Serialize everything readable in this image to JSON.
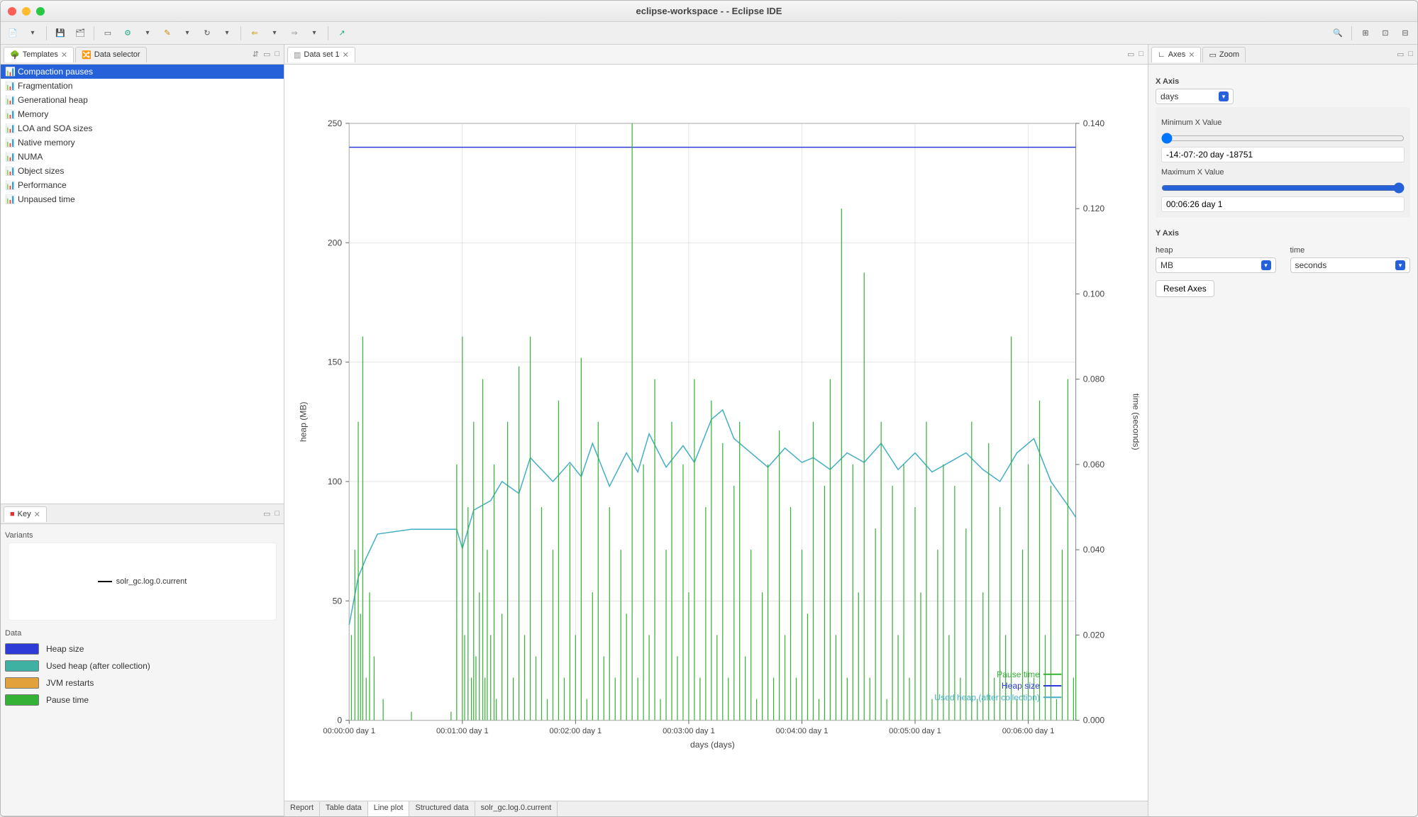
{
  "window": {
    "title": "eclipse-workspace -  - Eclipse IDE"
  },
  "left": {
    "templates_tab": "Templates",
    "data_selector_tab": "Data selector",
    "templates": [
      "Compaction pauses",
      "Fragmentation",
      "Generational heap",
      "Memory",
      "LOA and SOA sizes",
      "Native memory",
      "NUMA",
      "Object sizes",
      "Performance",
      "Unpaused time"
    ],
    "selected_index": 0,
    "key_tab": "Key",
    "variants_label": "Variants",
    "variant_name": "solr_gc.log.0.current",
    "data_label": "Data",
    "legend": [
      {
        "label": "Heap size",
        "color": "#2e3bd6"
      },
      {
        "label": "Used heap (after collection)",
        "color": "#3fb1a3"
      },
      {
        "label": "JVM restarts",
        "color": "#e2a23b"
      },
      {
        "label": "Pause time",
        "color": "#35b135"
      }
    ]
  },
  "center": {
    "tab": "Data set 1",
    "bottom_tabs": [
      "Report",
      "Table data",
      "Line plot",
      "Structured data",
      "solr_gc.log.0.current"
    ],
    "bottom_active": 2
  },
  "right": {
    "axes_tab": "Axes",
    "zoom_tab": "Zoom",
    "x_axis_label": "X Axis",
    "x_unit": "days",
    "min_x_label": "Minimum X Value",
    "min_x_value": "-14:-07:-20 day -18751",
    "max_x_label": "Maximum X Value",
    "max_x_value": "00:06:26 day 1",
    "y_axis_label": "Y Axis",
    "heap_label": "heap",
    "heap_unit": "MB",
    "time_label": "time",
    "time_unit": "seconds",
    "reset": "Reset Axes"
  },
  "chart_data": {
    "type": "line",
    "title": "",
    "xlabel": "days (days)",
    "y1": {
      "label": "heap (MB)",
      "ticks": [
        0,
        50,
        100,
        150,
        200,
        250
      ]
    },
    "y2": {
      "label": "time (seconds)",
      "ticks": [
        0.0,
        0.02,
        0.04,
        0.06,
        0.08,
        0.1,
        0.12,
        0.14
      ]
    },
    "x_ticks": [
      "00:00:00 day 1",
      "00:01:00 day 1",
      "00:02:00 day 1",
      "00:03:00 day 1",
      "00:04:00 day 1",
      "00:05:00 day 1",
      "00:06:00 day 1"
    ],
    "x_range": [
      0,
      6.42
    ],
    "legend_inplot": [
      "Pause time",
      "Heap size",
      "Used heap (after collection)"
    ],
    "series": [
      {
        "name": "Heap size",
        "axis": "y1",
        "color": "#2e3bd6",
        "x": [
          0,
          6.42
        ],
        "y": [
          240,
          240
        ]
      },
      {
        "name": "Used heap (after collection)",
        "axis": "y1",
        "color": "#45b0c4",
        "x": [
          0.0,
          0.08,
          0.15,
          0.25,
          0.55,
          0.95,
          1.0,
          1.1,
          1.25,
          1.35,
          1.5,
          1.6,
          1.8,
          1.95,
          2.05,
          2.15,
          2.3,
          2.45,
          2.55,
          2.65,
          2.8,
          2.95,
          3.05,
          3.2,
          3.3,
          3.4,
          3.55,
          3.7,
          3.85,
          4.0,
          4.1,
          4.25,
          4.4,
          4.55,
          4.7,
          4.85,
          5.0,
          5.15,
          5.3,
          5.45,
          5.6,
          5.75,
          5.9,
          6.05,
          6.2,
          6.35,
          6.42
        ],
        "y": [
          40,
          60,
          68,
          78,
          80,
          80,
          72,
          88,
          92,
          100,
          95,
          110,
          100,
          108,
          102,
          116,
          98,
          112,
          104,
          120,
          106,
          115,
          108,
          126,
          130,
          118,
          112,
          106,
          114,
          108,
          110,
          105,
          112,
          108,
          116,
          105,
          112,
          104,
          108,
          112,
          105,
          100,
          112,
          118,
          100,
          90,
          85
        ]
      },
      {
        "name": "Pause time",
        "axis": "y2",
        "color": "#35b135",
        "x": [
          0.02,
          0.05,
          0.08,
          0.1,
          0.12,
          0.15,
          0.18,
          0.22,
          0.3,
          0.55,
          0.9,
          0.95,
          1.0,
          1.02,
          1.05,
          1.08,
          1.1,
          1.12,
          1.15,
          1.18,
          1.2,
          1.22,
          1.25,
          1.28,
          1.3,
          1.35,
          1.4,
          1.45,
          1.5,
          1.55,
          1.6,
          1.65,
          1.7,
          1.75,
          1.8,
          1.85,
          1.9,
          1.95,
          2.0,
          2.05,
          2.1,
          2.15,
          2.2,
          2.25,
          2.3,
          2.35,
          2.4,
          2.45,
          2.5,
          2.55,
          2.6,
          2.65,
          2.7,
          2.75,
          2.8,
          2.85,
          2.9,
          2.95,
          3.0,
          3.05,
          3.1,
          3.15,
          3.2,
          3.25,
          3.3,
          3.35,
          3.4,
          3.45,
          3.5,
          3.55,
          3.6,
          3.65,
          3.7,
          3.75,
          3.8,
          3.85,
          3.9,
          3.95,
          4.0,
          4.05,
          4.1,
          4.15,
          4.2,
          4.25,
          4.3,
          4.35,
          4.4,
          4.45,
          4.5,
          4.55,
          4.6,
          4.65,
          4.7,
          4.75,
          4.8,
          4.85,
          4.9,
          4.95,
          5.0,
          5.05,
          5.1,
          5.15,
          5.2,
          5.25,
          5.3,
          5.35,
          5.4,
          5.45,
          5.5,
          5.55,
          5.6,
          5.65,
          5.7,
          5.75,
          5.8,
          5.85,
          5.9,
          5.95,
          6.0,
          6.05,
          6.1,
          6.15,
          6.2,
          6.25,
          6.3,
          6.35,
          6.4,
          6.42
        ],
        "y": [
          0.02,
          0.04,
          0.07,
          0.025,
          0.09,
          0.01,
          0.03,
          0.015,
          0.005,
          0.002,
          0.002,
          0.06,
          0.09,
          0.02,
          0.05,
          0.01,
          0.07,
          0.015,
          0.03,
          0.08,
          0.01,
          0.04,
          0.02,
          0.06,
          0.005,
          0.025,
          0.07,
          0.01,
          0.083,
          0.02,
          0.09,
          0.015,
          0.05,
          0.005,
          0.04,
          0.075,
          0.01,
          0.06,
          0.02,
          0.085,
          0.005,
          0.03,
          0.07,
          0.015,
          0.05,
          0.01,
          0.04,
          0.025,
          0.14,
          0.01,
          0.06,
          0.02,
          0.08,
          0.005,
          0.04,
          0.07,
          0.015,
          0.06,
          0.03,
          0.08,
          0.01,
          0.05,
          0.075,
          0.02,
          0.065,
          0.01,
          0.055,
          0.07,
          0.015,
          0.04,
          0.005,
          0.03,
          0.06,
          0.01,
          0.068,
          0.02,
          0.05,
          0.01,
          0.04,
          0.025,
          0.07,
          0.005,
          0.055,
          0.08,
          0.02,
          0.12,
          0.01,
          0.06,
          0.03,
          0.105,
          0.01,
          0.045,
          0.07,
          0.005,
          0.055,
          0.02,
          0.06,
          0.01,
          0.05,
          0.03,
          0.07,
          0.005,
          0.04,
          0.06,
          0.02,
          0.055,
          0.01,
          0.045,
          0.07,
          0.005,
          0.03,
          0.065,
          0.01,
          0.05,
          0.02,
          0.09,
          0.005,
          0.04,
          0.06,
          0.01,
          0.075,
          0.02,
          0.055,
          0.005,
          0.04,
          0.08,
          0.01,
          0.02
        ]
      }
    ]
  }
}
